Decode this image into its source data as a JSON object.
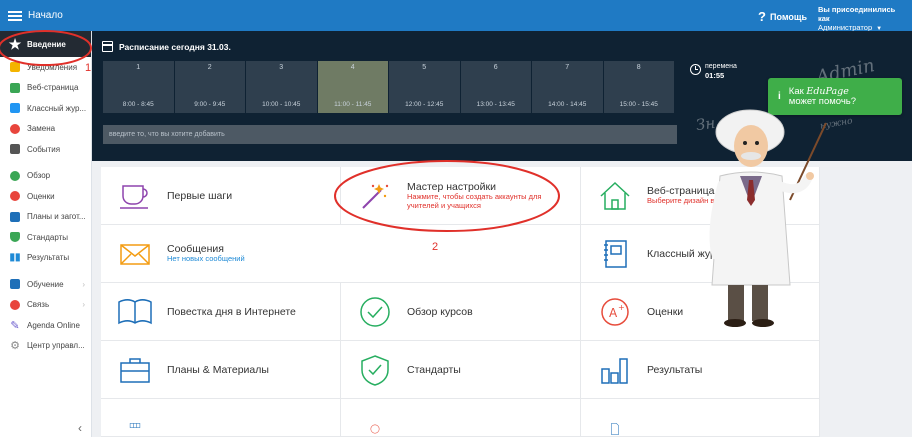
{
  "topbar": {
    "title": "Начало",
    "help_label": "Помощь",
    "user_line1": "Вы присоединились как",
    "user_line2": "Администратор"
  },
  "sidebar": {
    "items": [
      {
        "label": "Введение",
        "icon": "star-icon",
        "color": "#ffffff"
      },
      {
        "label": "Уведомления",
        "icon": "envelope-icon",
        "color": "#f4b400"
      },
      {
        "label": "Веб-страница",
        "icon": "home-icon",
        "color": "#3aa655"
      },
      {
        "label": "Классный жур...",
        "icon": "journal-icon",
        "color": "#2196f3"
      },
      {
        "label": "Замена",
        "icon": "person-icon",
        "color": "#e8453c"
      },
      {
        "label": "События",
        "icon": "calendar-icon",
        "color": "#555555"
      },
      {
        "label": "Обзор",
        "icon": "check-circle-icon",
        "color": "#3aa655"
      },
      {
        "label": "Оценки",
        "icon": "grade-icon",
        "color": "#e8453c"
      },
      {
        "label": "Планы и загот...",
        "icon": "plans-icon",
        "color": "#1e6fb8"
      },
      {
        "label": "Стандарты",
        "icon": "shield-icon",
        "color": "#3aa655"
      },
      {
        "label": "Результаты",
        "icon": "bar-chart-icon",
        "color": "#1e8ad6"
      },
      {
        "label": "Обучение",
        "icon": "learning-icon",
        "color": "#1e6fb8"
      },
      {
        "label": "Связь",
        "icon": "people-icon",
        "color": "#e8453c"
      },
      {
        "label": "Agenda Online",
        "icon": "pen-icon",
        "color": "#6a5acd"
      },
      {
        "label": "Центр управл...",
        "icon": "gear-icon",
        "color": "#888888"
      }
    ]
  },
  "schedule": {
    "title": "Расписание сегодня 31.03.",
    "periods": [
      {
        "num": "1",
        "time": "8:00 - 8:45"
      },
      {
        "num": "2",
        "time": "9:00 - 9:45"
      },
      {
        "num": "3",
        "time": "10:00 - 10:45"
      },
      {
        "num": "4",
        "time": "11:00 - 11:45"
      },
      {
        "num": "5",
        "time": "12:00 - 12:45"
      },
      {
        "num": "6",
        "time": "13:00 - 13:45"
      },
      {
        "num": "7",
        "time": "14:00 - 14:45"
      },
      {
        "num": "8",
        "time": "15:00 - 15:45"
      }
    ],
    "break_label": "перемена",
    "break_time": "01:55",
    "add_placeholder": "введите то, что вы хотите добавить"
  },
  "help_bubble": {
    "line1_prefix": "Как ",
    "brand": "EduPage",
    "line2": "может помочь?"
  },
  "tiles": {
    "first_steps": {
      "name": "Первые шаги"
    },
    "wizard": {
      "name": "Мастер настройки",
      "sub1": "Нажмите, чтобы создать аккаунты для",
      "sub2": "учителей и учащихся"
    },
    "web_page": {
      "name": "Веб-страница",
      "sub": "Выберите дизайн в"
    },
    "messages": {
      "name": "Сообщения",
      "sub": "Нет новых сообщений"
    },
    "class_journal": {
      "name": "Классный журнал"
    },
    "agenda": {
      "name": "Повестка дня в Интернете"
    },
    "courses": {
      "name": "Обзор курсов"
    },
    "grades": {
      "name": "Оценки"
    },
    "plans": {
      "name": "Планы & Материалы"
    },
    "standards": {
      "name": "Стандарты"
    },
    "results": {
      "name": "Результаты"
    }
  },
  "annotations": {
    "one": "1",
    "two": "2"
  },
  "colors": {
    "accent": "#1f7ac4",
    "annotation": "#e0302a",
    "help_green": "#3fae49"
  }
}
